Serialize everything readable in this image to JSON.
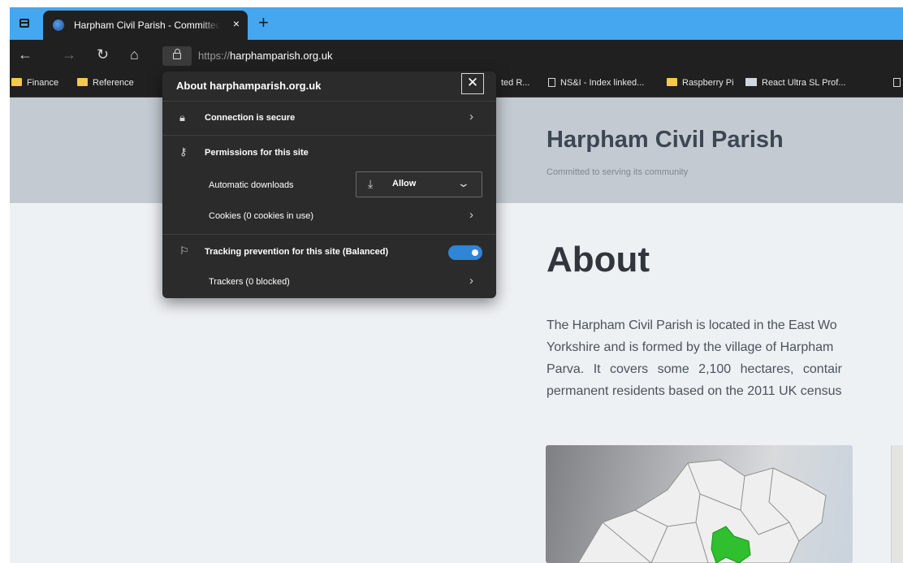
{
  "browser": {
    "tab": {
      "title": "Harpham Civil Parish - Committed to serving its community",
      "close": "×",
      "new_tab": "+"
    },
    "toolbar": {
      "back": "←",
      "forward": "→",
      "refresh": "↻",
      "home": "⌂",
      "url_scheme": "https://",
      "url_host": "harphamparish.org.uk"
    },
    "bookmarks": [
      {
        "label": "Finance",
        "icon": "folder-icon"
      },
      {
        "label": "Reference",
        "icon": "folder-icon"
      },
      {
        "label": "ted R...",
        "icon": "none"
      },
      {
        "label": "NS&I - Index linked...",
        "icon": "page-icon"
      },
      {
        "label": "Raspberry Pi",
        "icon": "folder-icon"
      },
      {
        "label": "React Ultra SL Prof...",
        "icon": "react-icon"
      }
    ]
  },
  "popup": {
    "title": "About harphamparish.org.uk",
    "close": "✕",
    "connection_label": "Connection is secure",
    "permissions_label": "Permissions for this site",
    "auto_downloads_label": "Automatic downloads",
    "auto_downloads_value": "Allow",
    "cookies_label": "Cookies (0 cookies in use)",
    "tracking_label": "Tracking prevention for this site (Balanced)",
    "tracking_enabled": true,
    "trackers_label": "Trackers (0 blocked)"
  },
  "page": {
    "site_title": "Harpham Civil Parish",
    "tagline": "Committed to serving its community",
    "about_heading": "About",
    "about_lines": [
      "The Harpham Civil Parish is located in the East Wo",
      "Yorkshire and is formed by the village of Harpham",
      "Parva. It covers some 2,100 hectares, contair",
      "permanent residents based on the 2011 UK census"
    ]
  },
  "colors": {
    "tabstrip": "#45a7f0",
    "chrome": "#202020",
    "popup": "#2b2b2b",
    "toggle": "#2f86d6",
    "hero": "#c3cad1",
    "map_highlight": "#2fbf2f"
  }
}
